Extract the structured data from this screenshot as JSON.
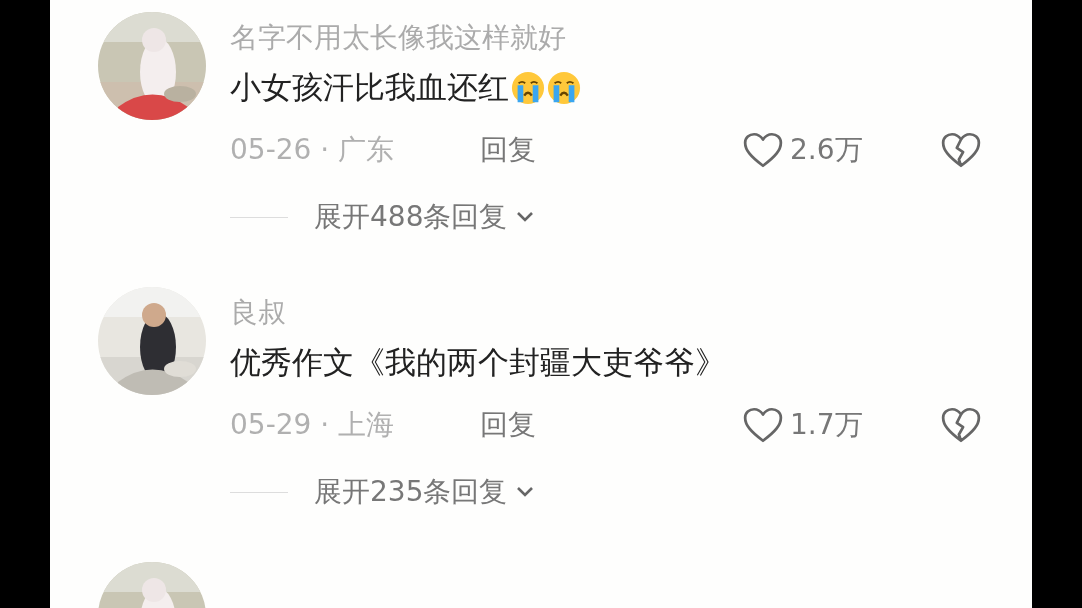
{
  "comments": [
    {
      "avatar": {
        "kind": "picture"
      },
      "name": "名字不用太长像我这样就好",
      "text": "小女孩汗比我血还红",
      "emojis": [
        {
          "kind": "crying"
        },
        {
          "kind": "crying"
        }
      ],
      "date": "05-26 · 广东",
      "reply": "回复",
      "likes": "2.6万",
      "expand": "展开488条回复"
    },
    {
      "avatar": {
        "kind": "picture"
      },
      "name": "良叔",
      "text": "优秀作文《我的两个封疆大吏爷爷》",
      "date": "05-29 · 上海",
      "reply": "回复",
      "likes": "1.7万",
      "expand": "展开235条回复"
    },
    {
      "avatar": {
        "kind": "picture"
      }
    }
  ]
}
